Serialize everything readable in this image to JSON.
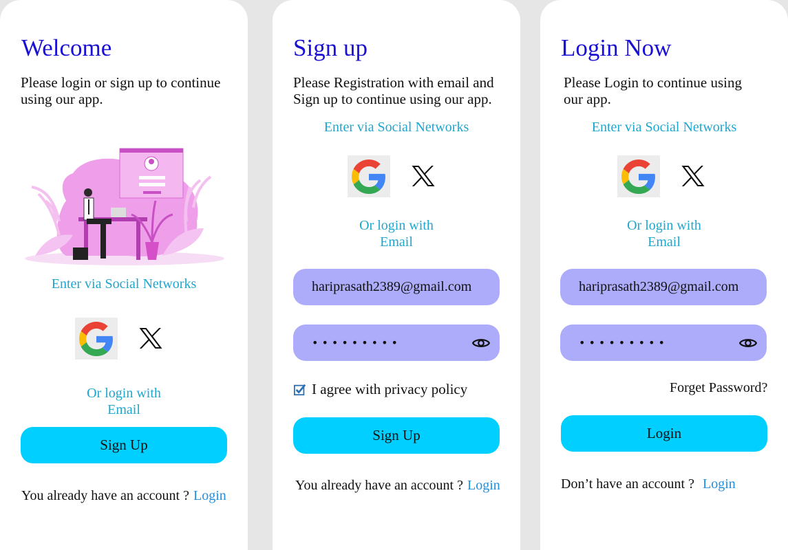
{
  "welcome": {
    "title": "Welcome",
    "subtitle": "Please login or sign up to continue using our app.",
    "social_title": "Enter via Social Networks",
    "or_login_line1": "Or login with",
    "or_login_line2": "Email",
    "signup_button": "Sign Up",
    "footer_text": "You already have an account ?",
    "footer_link": "Login"
  },
  "signup": {
    "title": "Sign up",
    "subtitle": "Please Registration with email and Sign up to continue using our app.",
    "social_title": "Enter via Social Networks",
    "or_login_line1": "Or login with",
    "or_login_line2": "Email",
    "email_value": "hariprasath2389@gmail.com",
    "password_mask": "•••••••••",
    "agree_label": "I agree with privacy policy",
    "agree_checked": true,
    "signup_button": "Sign Up",
    "footer_text": "You already have an account ?",
    "footer_link": "Login"
  },
  "login": {
    "title": "Login Now",
    "subtitle": "Please Login to continue using our app.",
    "social_title": "Enter via Social Networks",
    "or_login_line1": "Or login with",
    "or_login_line2": "Email",
    "email_value": "hariprasath2389@gmail.com",
    "password_mask": "•••••••••",
    "forgot_label": "Forget Password?",
    "login_button": "Login",
    "footer_text": "Don’t have an account ?",
    "footer_link": "Login"
  },
  "colors": {
    "title": "#1a10d4",
    "accent_text": "#1fa6cf",
    "link": "#1f8fe0",
    "primary_button": "#00cfff",
    "input_bg": "#acacfa",
    "page_bg": "#e6e6e6"
  },
  "icons": [
    "google-icon",
    "x-icon",
    "eye-icon",
    "checkbox-icon"
  ]
}
